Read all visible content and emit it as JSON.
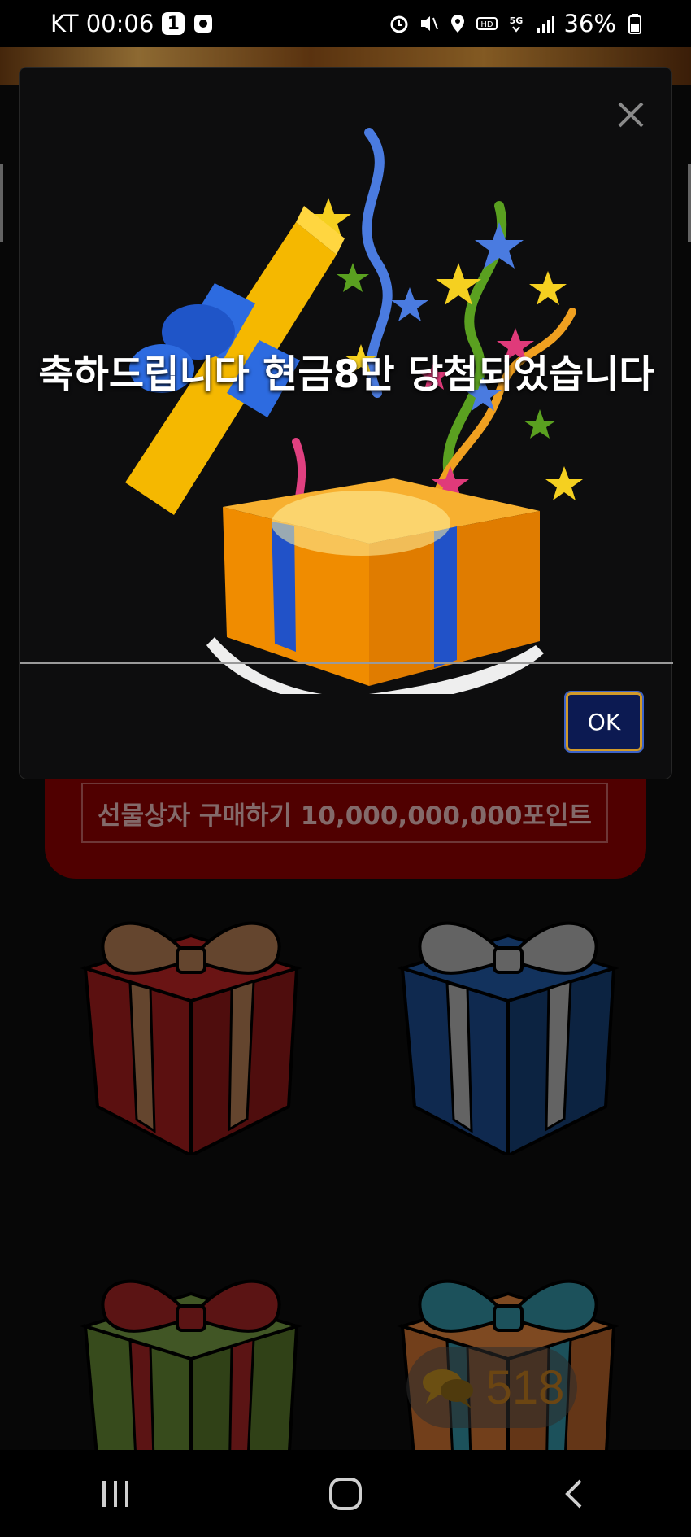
{
  "status_bar": {
    "carrier_time": "KT 00:06",
    "notif_count": "1",
    "battery": "36%"
  },
  "page": {
    "buy_button_label": "선물상자 구매하기 10,000,000,000포인트",
    "chat_count": "518",
    "gift_colors": [
      "#8c1a1a",
      "#17407a",
      "#55732b",
      "#b0622a"
    ]
  },
  "dialog": {
    "message": "축하드립니다 현금8만 당첨되었습니다",
    "ok_label": "OK"
  },
  "icons": [
    "alarm-icon",
    "mute-icon",
    "location-icon",
    "hd-icon",
    "5g-icon",
    "signal-icon",
    "battery-icon",
    "close-icon",
    "chat-icon",
    "recent-apps-icon",
    "home-icon",
    "back-icon"
  ]
}
